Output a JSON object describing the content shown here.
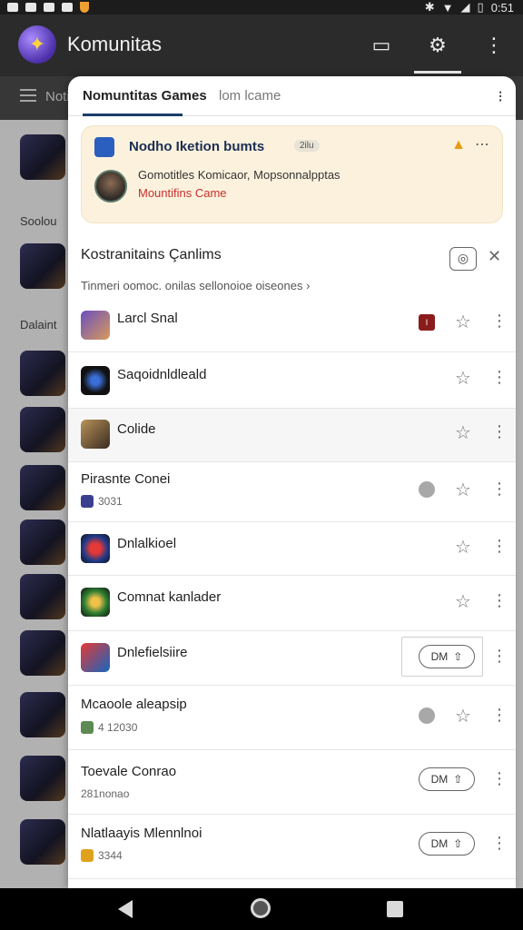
{
  "app": {
    "title": "Komunitas",
    "colors": {
      "appbar": "#2b2b2b",
      "accent_dark_blue": "#1a3d6b",
      "notif_bg": "#fbf1dd",
      "alert_red": "#c9302c"
    }
  },
  "status_bar": {
    "time": "0:51"
  },
  "background": {
    "toolbar_text": "Noti",
    "sections": [
      "Soolou",
      "Dalaint"
    ]
  },
  "panel": {
    "tab_active": "Nomuntitas Games",
    "tab_secondary": "lom lcame",
    "notification": {
      "title": "Nodho Iketion bumts",
      "time": "2ilu",
      "body": "Gomotitles Komicaor, Mopsonnalpptas",
      "sub": "Mountifins Came"
    },
    "section": {
      "title": "Kostranitains Çanlims",
      "subtitle": "Tinmeri oomoc. onilas sellonoioe oiseones ›"
    },
    "rows": [
      {
        "title": "Larcl Snal",
        "badge": "I"
      },
      {
        "title": "Saqoidnldleald"
      },
      {
        "title": "Colide"
      },
      {
        "title": "Pirasnte Conei",
        "meta": "3031"
      },
      {
        "title": "Dnlalkioel"
      },
      {
        "title": "Comnat kanlader"
      },
      {
        "title": "Dnlefielsiire",
        "pill": "DM"
      },
      {
        "title": "Mcaoole aleapsip",
        "meta": "4 12030"
      },
      {
        "title": "Toevale Conrao",
        "meta": "281nonao",
        "pill": "DM"
      },
      {
        "title": "Nlatlaayis Mlennlnoi",
        "meta": "3344",
        "pill": "DM"
      }
    ]
  }
}
